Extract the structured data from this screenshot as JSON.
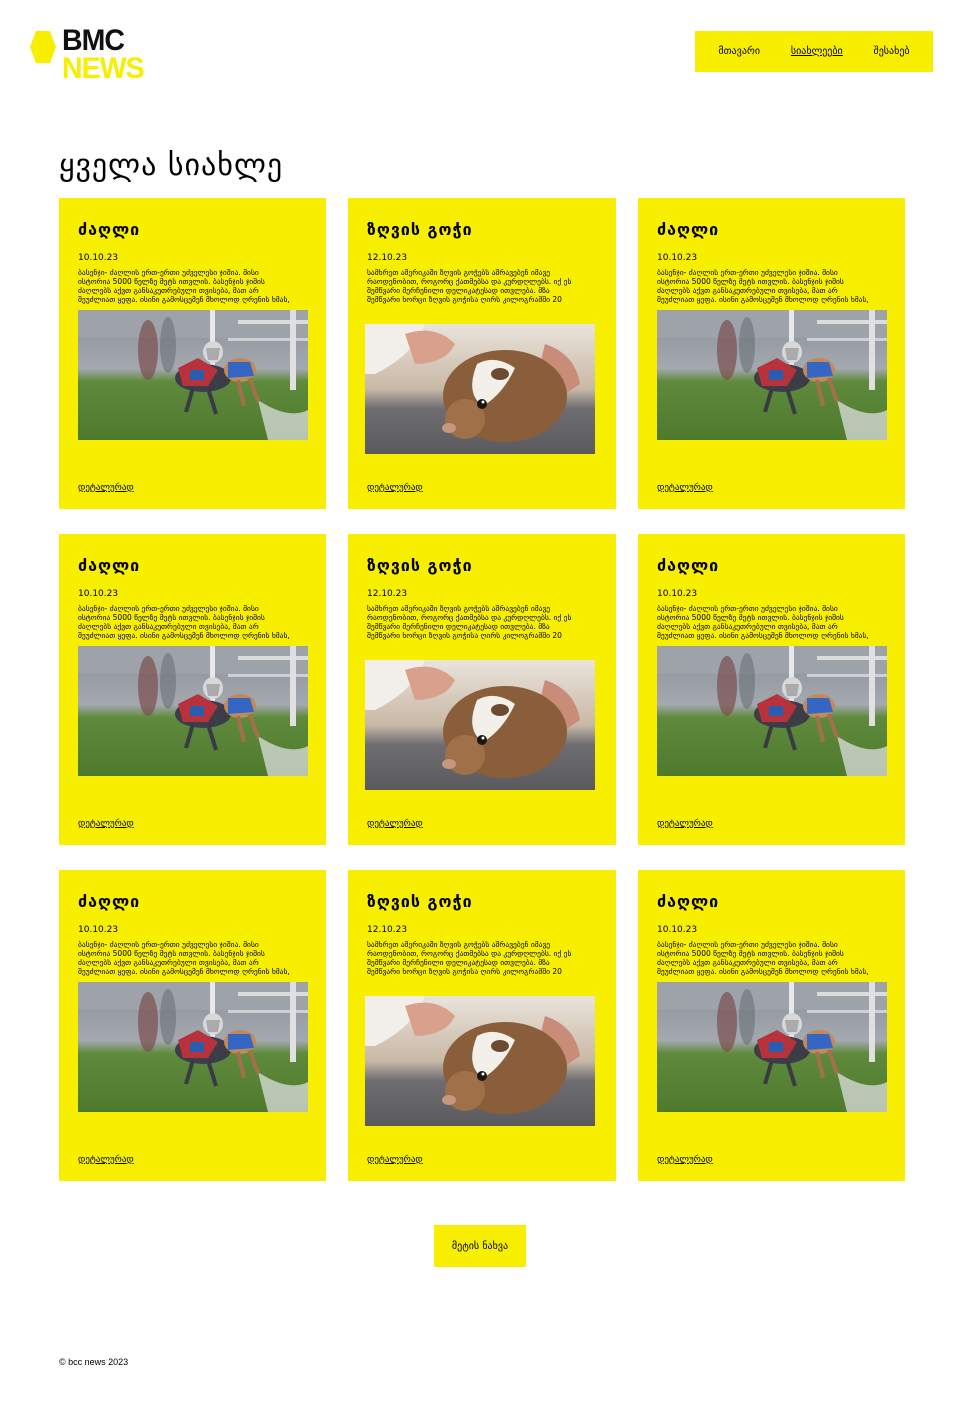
{
  "header": {
    "logo_top": "BMC",
    "logo_bottom": "NEWS",
    "nav": [
      {
        "label": "მთავარი",
        "active": false
      },
      {
        "label": "სიახლეები",
        "active": true
      },
      {
        "label": "შესახებ",
        "active": false
      }
    ]
  },
  "page_title": "ყველა სიახლე",
  "cards": [
    {
      "title": "ძაღლი",
      "date": "10.10.23",
      "text": "ბასენჯი- ძაღლის ერთ-ერთი უძველესი ჯიშია. მისი ისტორია 5000 წელზე მეტს ითვლის. ბასენჯის ჯიშის ძაღლებს აქვთ განსაკუთრებული თვისება, მათ არ შეუძლიათ ყეფა. ისინი გამოსცემენ მხოლოდ ღრენის ხმას,",
      "image": "dog",
      "link": "დეტალურად"
    },
    {
      "title": "ზღვის გოჭი",
      "date": "12.10.23",
      "text": "სამხრეთ ამერიკაში ზღვის გოჭებს აშრავებენ იმავე რაოდენობით, როგორც ქათმებსა და კურდღლებს. იქ ეს შემწვარი მერჩენილი დელიკატესად ითვლება. მზა შემწვარი ხორცი ზღვის გოჭისა ღირს კილოგრამში 20",
      "image": "guinea-pig",
      "link": "დეტალურად"
    },
    {
      "title": "ძაღლი",
      "date": "10.10.23",
      "text": "ბასენჯი- ძაღლის ერთ-ერთი უძველესი ჯიშია. მისი ისტორია 5000 წელზე მეტს ითვლის. ბასენჯის ჯიშის ძაღლებს აქვთ განსაკუთრებული თვისება, მათ არ შეუძლიათ ყეფა. ისინი გამოსცემენ მხოლოდ ღრენის ხმას,",
      "image": "dog",
      "link": "დეტალურად"
    },
    {
      "title": "ძაღლი",
      "date": "10.10.23",
      "text": "ბასენჯი- ძაღლის ერთ-ერთი უძველესი ჯიშია. მისი ისტორია 5000 წელზე მეტს ითვლის. ბასენჯის ჯიშის ძაღლებს აქვთ განსაკუთრებული თვისება, მათ არ შეუძლიათ ყეფა. ისინი გამოსცემენ მხოლოდ ღრენის ხმას,",
      "image": "dog",
      "link": "დეტალურად"
    },
    {
      "title": "ზღვის გოჭი",
      "date": "12.10.23",
      "text": "სამხრეთ ამერიკაში ზღვის გოჭებს აშრავებენ იმავე რაოდენობით, როგორც ქათმებსა და კურდღლებს. იქ ეს შემწვარი მერჩენილი დელიკატესად ითვლება. მზა შემწვარი ხორცი ზღვის გოჭისა ღირს კილოგრამში 20",
      "image": "guinea-pig",
      "link": "დეტალურად"
    },
    {
      "title": "ძაღლი",
      "date": "10.10.23",
      "text": "ბასენჯი- ძაღლის ერთ-ერთი უძველესი ჯიშია. მისი ისტორია 5000 წელზე მეტს ითვლის. ბასენჯის ჯიშის ძაღლებს აქვთ განსაკუთრებული თვისება, მათ არ შეუძლიათ ყეფა. ისინი გამოსცემენ მხოლოდ ღრენის ხმას,",
      "image": "dog",
      "link": "დეტალურად"
    },
    {
      "title": "ძაღლი",
      "date": "10.10.23",
      "text": "ბასენჯი- ძაღლის ერთ-ერთი უძველესი ჯიშია. მისი ისტორია 5000 წელზე მეტს ითვლის. ბასენჯის ჯიშის ძაღლებს აქვთ განსაკუთრებული თვისება, მათ არ შეუძლიათ ყეფა. ისინი გამოსცემენ მხოლოდ ღრენის ხმას,",
      "image": "dog",
      "link": "დეტალურად"
    },
    {
      "title": "ზღვის გოჭი",
      "date": "12.10.23",
      "text": "სამხრეთ ამერიკაში ზღვის გოჭებს აშრავებენ იმავე რაოდენობით, როგორც ქათმებსა და კურდღლებს. იქ ეს შემწვარი მერჩენილი დელიკატესად ითვლება. მზა შემწვარი ხორცი ზღვის გოჭისა ღირს კილოგრამში 20",
      "image": "guinea-pig",
      "link": "დეტალურად"
    },
    {
      "title": "ძაღლი",
      "date": "10.10.23",
      "text": "ბასენჯი- ძაღლის ერთ-ერთი უძველესი ჯიშია. მისი ისტორია 5000 წელზე მეტს ითვლის. ბასენჯის ჯიშის ძაღლებს აქვთ განსაკუთრებული თვისება, მათ არ შეუძლიათ ყეფა. ისინი გამოსცემენ მხოლოდ ღრენის ხმას,",
      "image": "dog",
      "link": "დეტალურად"
    }
  ],
  "more_button": "მეტის ნახვა",
  "footer": "© bcc news 2023",
  "colors": {
    "accent": "#f7ee00",
    "text": "#000000",
    "background": "#ffffff"
  }
}
